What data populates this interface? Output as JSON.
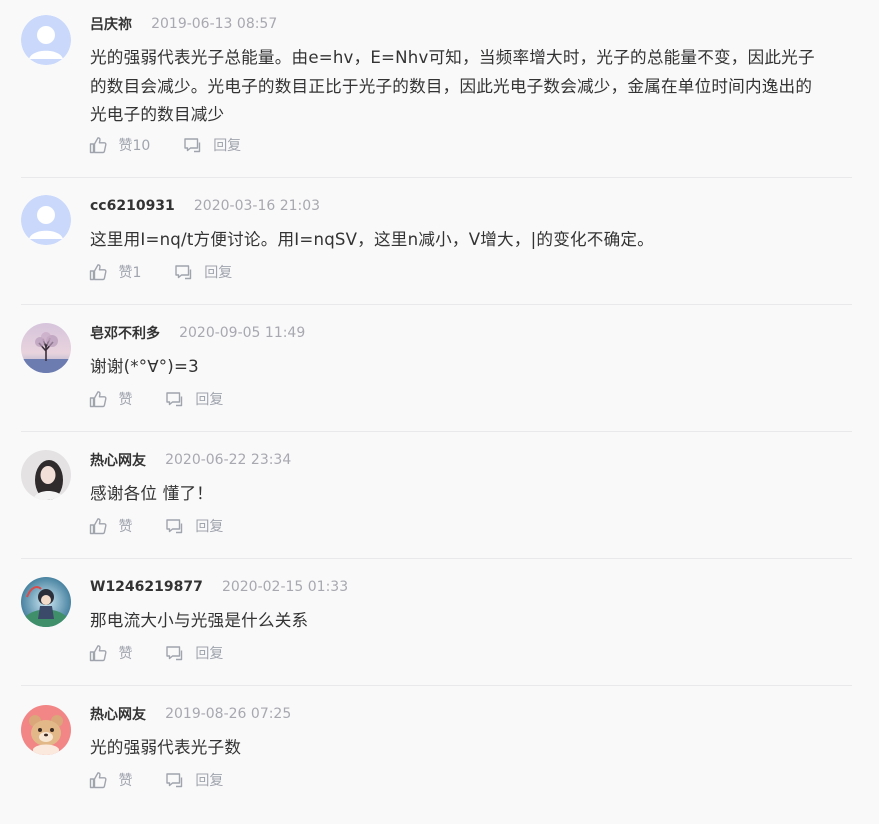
{
  "comments": [
    {
      "username": "吕庆祢",
      "time": "2019-06-13 08:57",
      "avatar": "default-avatar-icon",
      "lines": [
        "光的强弱代表光子总能量。由e=hv，E=Nhv可知，当频率增大时，光子的总能量不变，因此光子",
        "的数目会减少。光电子的数目正比于光子的数目，因此光电子数会减少，金属在单位时间内逸出的",
        "光电子的数目减少"
      ],
      "like_label": "赞10",
      "reply_label": "回复"
    },
    {
      "username": "cc6210931",
      "time": "2020-03-16 21:03",
      "avatar": "default-avatar-icon",
      "lines": [
        "这里用I=nq/t方便讨论。用I=nqSV，这里n减小，V增大，|的变化不确定。"
      ],
      "like_label": "赞1",
      "reply_label": "回复"
    },
    {
      "username": "皂邓不利多",
      "time": "2020-09-05 11:49",
      "avatar": "tree-photo-avatar",
      "lines": [
        "谢谢(*°∀°)=3"
      ],
      "like_label": "赞",
      "reply_label": "回复"
    },
    {
      "username": "热心网友",
      "time": "2020-06-22 23:34",
      "avatar": "portrait-photo-avatar",
      "lines": [
        "感谢各位 懂了！"
      ],
      "like_label": "赞",
      "reply_label": "回复"
    },
    {
      "username": "W1246219877",
      "time": "2020-02-15 01:33",
      "avatar": "anime-character-avatar",
      "lines": [
        "那电流大小与光强是什么关系"
      ],
      "like_label": "赞",
      "reply_label": "回复"
    },
    {
      "username": "热心网友",
      "time": "2019-08-26 07:25",
      "avatar": "cartoon-bear-avatar",
      "lines": [
        "光的强弱代表光子数"
      ],
      "like_label": "赞",
      "reply_label": "回复"
    }
  ],
  "colors": {
    "username": "#333333",
    "timestamp": "#a8a8b0",
    "content": "#333333",
    "action": "#a0a4ad",
    "divider": "#e9e9ec",
    "default_avatar": "#c9d8fb"
  }
}
